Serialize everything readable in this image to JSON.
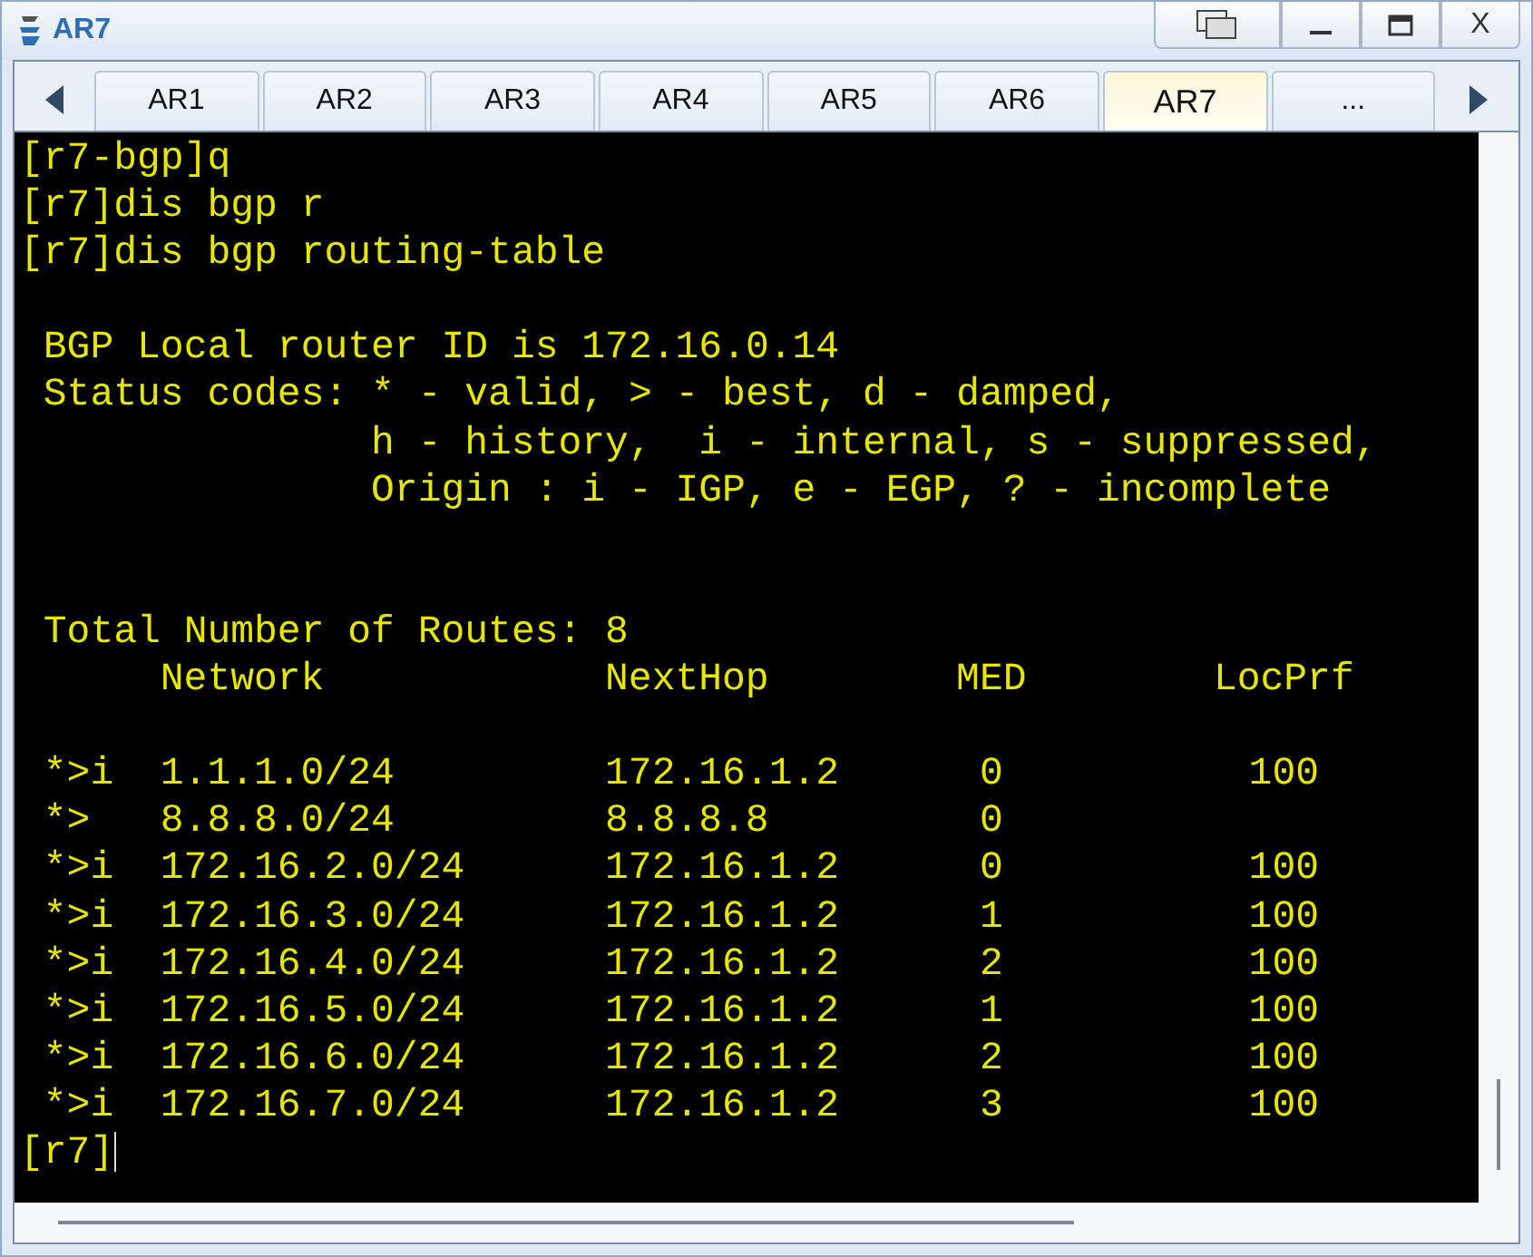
{
  "window": {
    "title": "AR7",
    "close_button": "X"
  },
  "tabs": [
    {
      "label": "AR1",
      "selected": false
    },
    {
      "label": "AR2",
      "selected": false
    },
    {
      "label": "AR3",
      "selected": false
    },
    {
      "label": "AR4",
      "selected": false
    },
    {
      "label": "AR5",
      "selected": false
    },
    {
      "label": "AR6",
      "selected": false
    },
    {
      "label": "AR7",
      "selected": true
    },
    {
      "label": "...",
      "selected": false
    }
  ],
  "terminal": {
    "commands": [
      "[r7-bgp]q",
      "[r7]dis bgp r",
      "[r7]dis bgp routing-table"
    ],
    "router_id": "BGP Local router ID is 172.16.0.14",
    "status_codes_label": "Status codes:",
    "status_codes": [
      "* - valid, > - best, d - damped,",
      "h - history,  i - internal, s - suppressed,",
      "Origin : i - IGP, e - EGP, ? - incomplete"
    ],
    "total_routes": "Total Number of Routes: 8",
    "columns": [
      "Network",
      "NextHop",
      "MED",
      "LocPrf"
    ],
    "rows": [
      {
        "status": "*>i",
        "network": "1.1.1.0/24",
        "next_hop": "172.16.1.2",
        "med": "0",
        "loc_prf": "100"
      },
      {
        "status": "*>",
        "network": "8.8.8.0/24",
        "next_hop": "8.8.8.8",
        "med": "0"
      },
      {
        "status": "*>i",
        "network": "172.16.2.0/24",
        "next_hop": "172.16.1.2",
        "med": "0",
        "loc_prf": "100"
      },
      {
        "status": "*>i",
        "network": "172.16.3.0/24",
        "next_hop": "172.16.1.2",
        "med": "1",
        "loc_prf": "100"
      },
      {
        "status": "*>i",
        "network": "172.16.4.0/24",
        "next_hop": "172.16.1.2",
        "med": "2",
        "loc_prf": "100"
      },
      {
        "status": "*>i",
        "network": "172.16.5.0/24",
        "next_hop": "172.16.1.2",
        "med": "1",
        "loc_prf": "100"
      },
      {
        "status": "*>i",
        "network": "172.16.6.0/24",
        "next_hop": "172.16.1.2",
        "med": "2",
        "loc_prf": "100"
      },
      {
        "status": "*>i",
        "network": "172.16.7.0/24",
        "next_hop": "172.16.1.2",
        "med": "3",
        "loc_prf": "100"
      }
    ],
    "prompt": "[r7]"
  }
}
